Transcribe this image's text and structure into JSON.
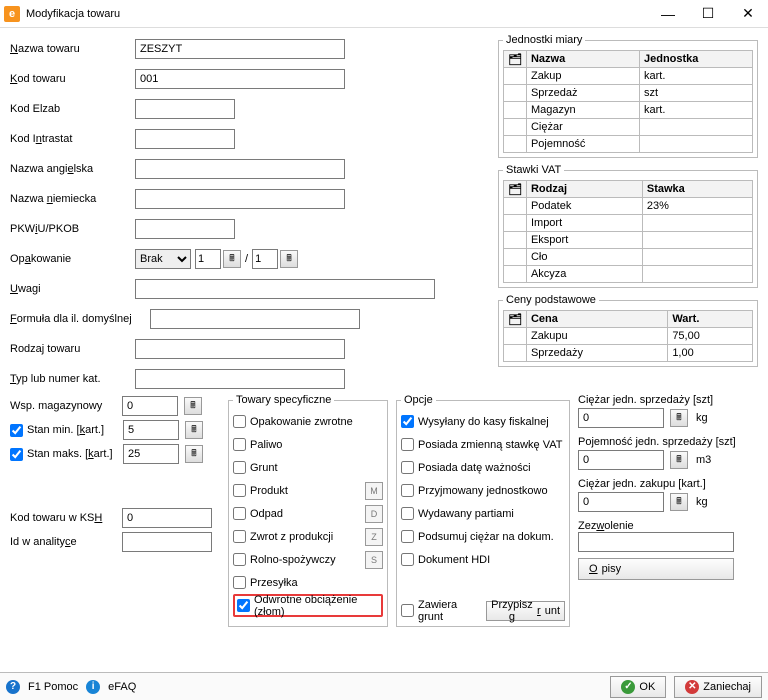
{
  "window": {
    "title": "Modyfikacja towaru"
  },
  "labels": {
    "nazwa": "Nazwa towaru",
    "kod": "Kod towaru",
    "elzab": "Kod Elzab",
    "intrastat": "Kod Intrastat",
    "ang": "Nazwa angielska",
    "niem": "Nazwa niemiecka",
    "pkwiu": "PKWiU/PKOB",
    "opak": "Opakowanie",
    "uwagi": "Uwagi",
    "formula": "Formuła dla il. domyślnej",
    "rodzaj": "Rodzaj towaru",
    "typ": "Typ lub numer kat.",
    "slash": "/"
  },
  "form": {
    "nazwa": "ZESZYT",
    "kod": "001",
    "elzab": "",
    "intrastat": "",
    "ang": "",
    "niem": "",
    "pkwiu": "",
    "opak_select": "Brak",
    "opak_n1": "1",
    "opak_n2": "1",
    "uwagi": "",
    "formula": "",
    "rodzaj": "",
    "typ": ""
  },
  "jednostki": {
    "legend": "Jednostki miary",
    "cols": [
      "Nazwa",
      "Jednostka"
    ],
    "rows": [
      [
        "Zakup",
        "kart."
      ],
      [
        "Sprzedaż",
        "szt"
      ],
      [
        "Magazyn",
        "kart."
      ],
      [
        "Ciężar",
        ""
      ],
      [
        "Pojemność",
        ""
      ]
    ]
  },
  "vat": {
    "legend": "Stawki VAT",
    "cols": [
      "Rodzaj",
      "Stawka"
    ],
    "rows": [
      [
        "Podatek",
        "23%"
      ],
      [
        "Import",
        ""
      ],
      [
        "Eksport",
        ""
      ],
      [
        "Cło",
        ""
      ],
      [
        "Akcyza",
        ""
      ]
    ]
  },
  "ceny": {
    "legend": "Ceny podstawowe",
    "cols": [
      "Cena",
      "Wart."
    ],
    "rows": [
      [
        "Zakupu",
        "75,00"
      ],
      [
        "Sprzedaży",
        "1,00"
      ]
    ]
  },
  "mag": {
    "wsp_label": "Wsp. magazynowy",
    "wsp": "0",
    "stanmin_label": "Stan min. [kart.]",
    "stanmin": "5",
    "stanmax_label": "Stan maks. [kart.]",
    "stanmax": "25",
    "ksh_label": "Kod towaru w KSH",
    "ksh": "0",
    "anal_label": "Id w analityce",
    "anal": ""
  },
  "spec": {
    "legend": "Towary specyficzne",
    "items": [
      "Opakowanie zwrotne",
      "Paliwo",
      "Grunt",
      "Produkt",
      "Odpad",
      "Zwrot z produkcji",
      "Rolno-spożywczy",
      "Przesyłka",
      "Odwrotne obciążenie (złom)"
    ],
    "letters": {
      "3": "M",
      "4": "D",
      "5": "Z",
      "6": "S"
    }
  },
  "opcje": {
    "legend": "Opcje",
    "items": [
      "Wysyłany do kasy fiskalnej",
      "Posiada zmienną stawkę VAT",
      "Posiada datę ważności",
      "Przyjmowany jednostkowo",
      "Wydawany partiami",
      "Podsumuj ciężar na dokum.",
      "Dokument HDI"
    ],
    "checked": [
      true,
      false,
      false,
      false,
      false,
      false,
      false
    ],
    "zawiera": "Zawiera grunt",
    "przypisz": "Przypisz grunt"
  },
  "props": {
    "ciezar_sp_label": "Ciężar jedn. sprzedaży [szt]",
    "ciezar_sp": "0",
    "poj_sp_label": "Pojemność jedn. sprzedaży [szt]",
    "poj_sp": "0",
    "ciezar_zk_label": "Ciężar jedn. zakupu [kart.]",
    "ciezar_zk": "0",
    "zezw_label": "Zezwolenie",
    "zezw": "",
    "opisy": "Opisy",
    "kg": "kg",
    "m3": "m3"
  },
  "footer": {
    "pomoc": "F1 Pomoc",
    "efaq": "eFAQ",
    "ok": "OK",
    "cancel": "Zaniechaj"
  }
}
